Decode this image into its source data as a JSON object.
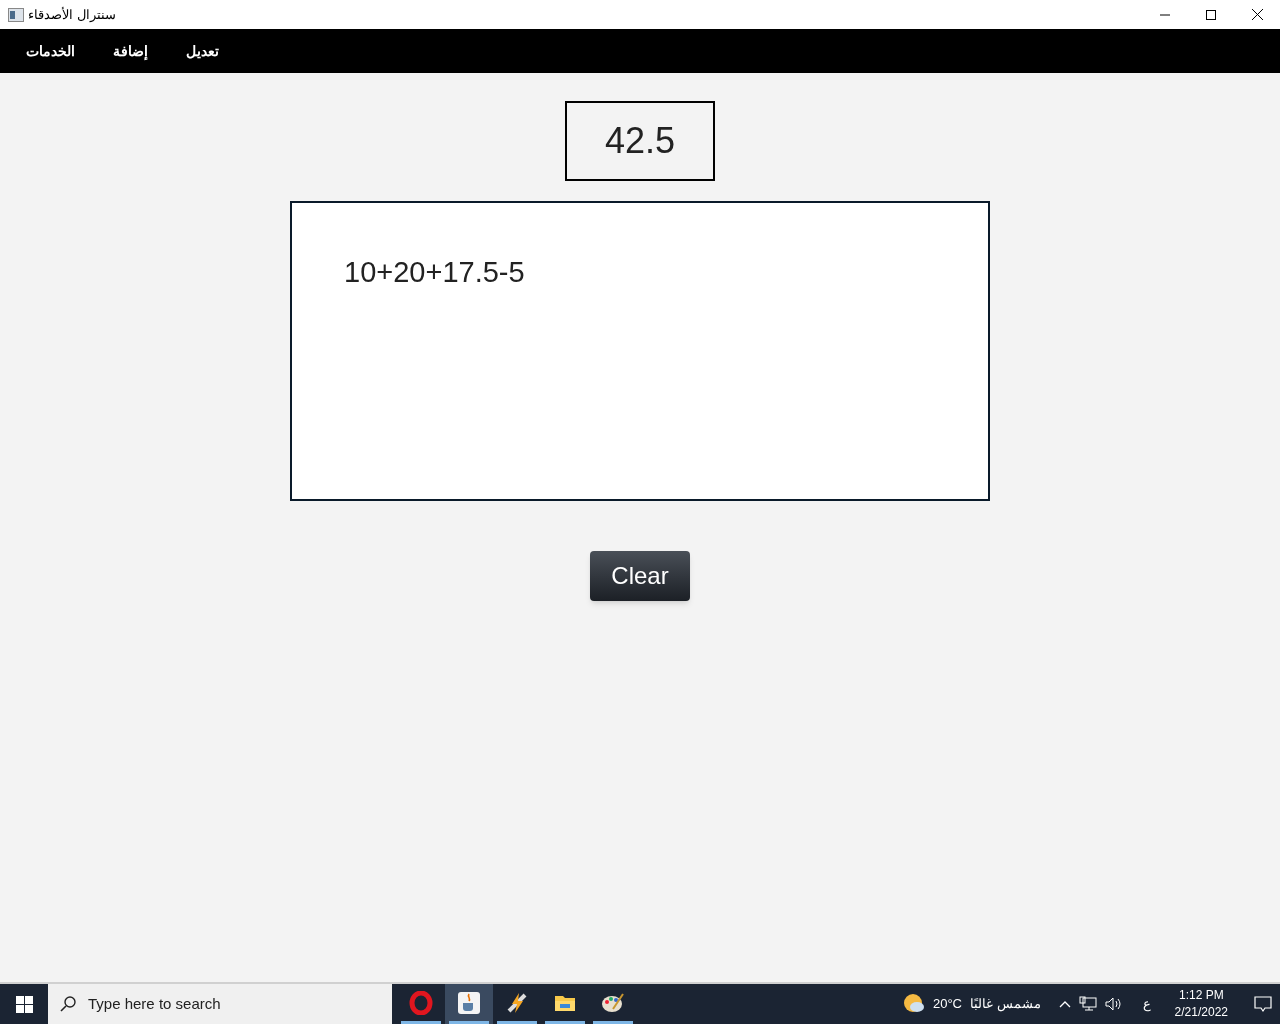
{
  "window": {
    "title": "سنترال الأصدقاء"
  },
  "menu": [
    {
      "label": "تعديل"
    },
    {
      "label": "إضافة"
    },
    {
      "label": "الخدمات"
    }
  ],
  "result": "42.5",
  "expression": "10+20+17.5-5",
  "clear_button": "Clear",
  "taskbar": {
    "search_placeholder": "Type here to search",
    "apps": [
      {
        "kind": "opera",
        "selected": false
      },
      {
        "kind": "java",
        "selected": true
      },
      {
        "kind": "bolt",
        "selected": false
      },
      {
        "kind": "folder",
        "selected": false
      },
      {
        "kind": "paint",
        "selected": false
      }
    ],
    "weather": {
      "temperature": "20°C",
      "condition": "مشمس غالبًا"
    },
    "language": "ع",
    "time": "1:12 PM",
    "date": "2/21/2022"
  }
}
